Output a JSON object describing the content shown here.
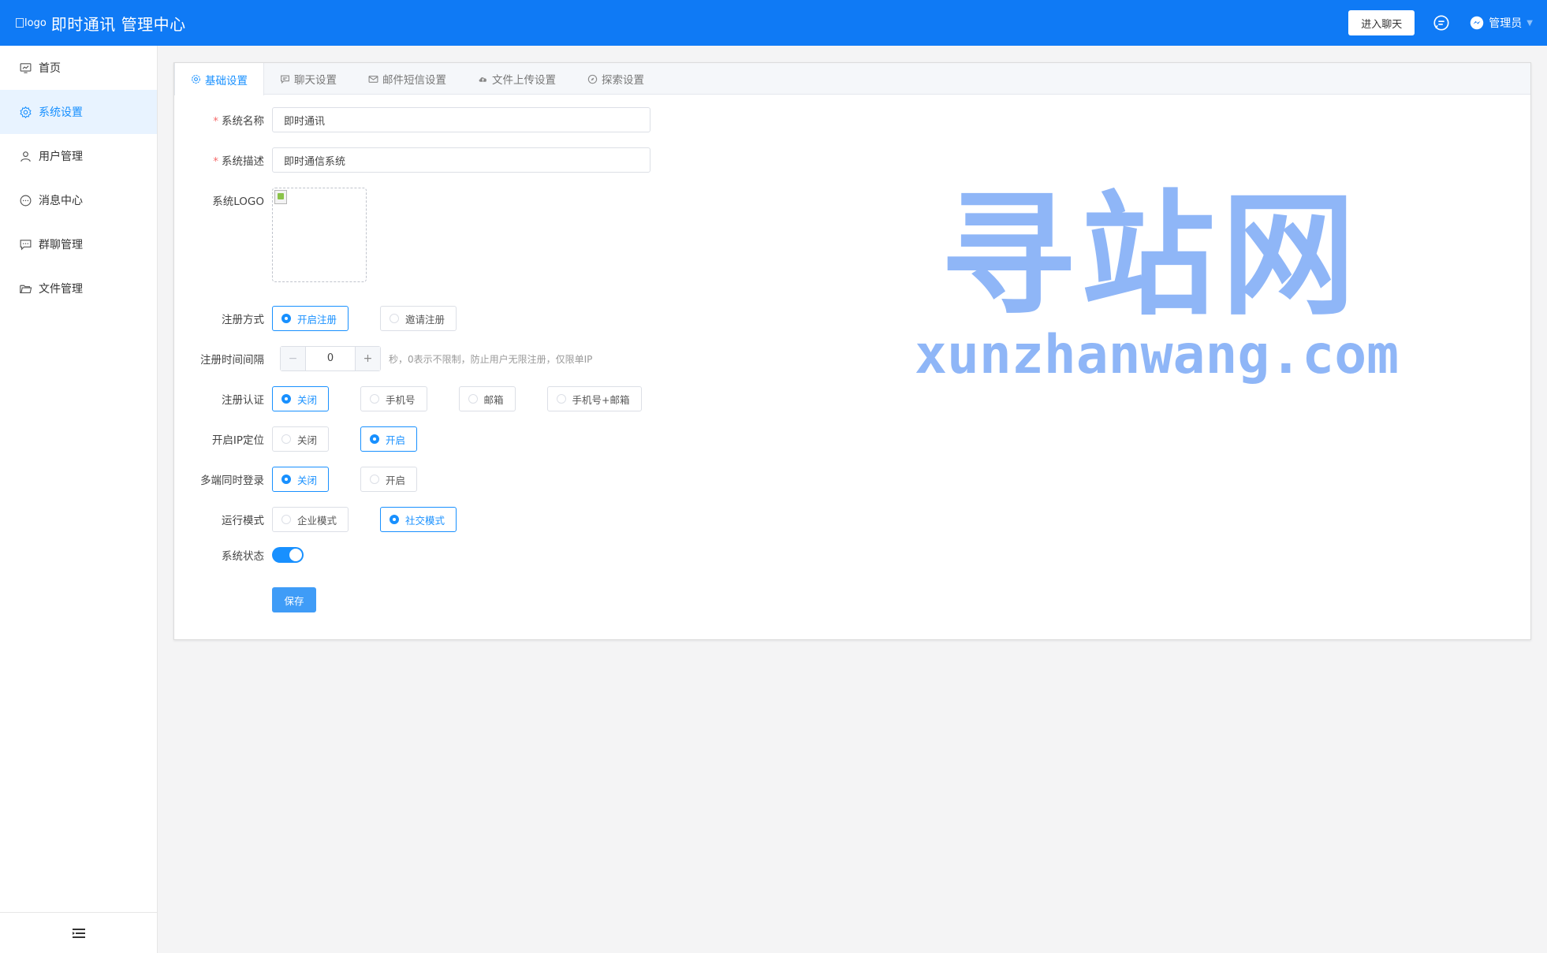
{
  "header": {
    "logo_alt": "logo",
    "title": "即时通讯 管理中心",
    "enter_chat": "进入聊天",
    "admin_name": "管理员"
  },
  "sidebar": {
    "items": [
      {
        "label": "首页",
        "icon": "dashboard-icon"
      },
      {
        "label": "系统设置",
        "icon": "gear-icon"
      },
      {
        "label": "用户管理",
        "icon": "user-icon"
      },
      {
        "label": "消息中心",
        "icon": "message-icon"
      },
      {
        "label": "群聊管理",
        "icon": "group-chat-icon"
      },
      {
        "label": "文件管理",
        "icon": "folder-icon"
      }
    ],
    "active_index": 1
  },
  "tabs": [
    "基础设置",
    "聊天设置",
    "邮件短信设置",
    "文件上传设置",
    "探索设置"
  ],
  "form": {
    "system_name": {
      "label": "系统名称",
      "value": "即时通讯"
    },
    "system_desc": {
      "label": "系统描述",
      "value": "即时通信系统"
    },
    "system_logo": {
      "label": "系统LOGO"
    },
    "register_mode": {
      "label": "注册方式",
      "options": [
        "开启注册",
        "邀请注册"
      ],
      "selected": 0
    },
    "register_interval": {
      "label": "注册时间间隔",
      "value": "0",
      "minus": "−",
      "plus": "+",
      "hint": "秒，0表示不限制，防止用户无限注册，仅限单IP"
    },
    "register_auth": {
      "label": "注册认证",
      "options": [
        "关闭",
        "手机号",
        "邮箱",
        "手机号+邮箱"
      ],
      "selected": 0
    },
    "ip_location": {
      "label": "开启IP定位",
      "options": [
        "关闭",
        "开启"
      ],
      "selected": 1
    },
    "multi_login": {
      "label": "多端同时登录",
      "options": [
        "关闭",
        "开启"
      ],
      "selected": 0
    },
    "run_mode": {
      "label": "运行模式",
      "options": [
        "企业模式",
        "社交模式"
      ],
      "selected": 1
    },
    "system_status": {
      "label": "系统状态",
      "on": true
    },
    "save": "保存"
  },
  "watermark": {
    "cn": "寻站网",
    "en": "xunzhanwang.com"
  },
  "colors": {
    "primary": "#0f7af5",
    "accent": "#1890ff"
  }
}
